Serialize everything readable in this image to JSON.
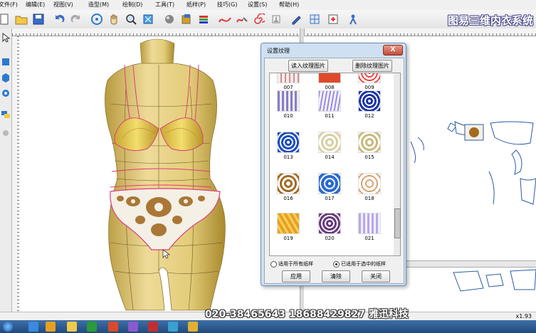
{
  "menu": [
    "文件(F)",
    "编辑(E)",
    "视图(V)",
    "造型(M)",
    "绘制(D)",
    "工具(T)",
    "纸样(P)",
    "技巧(G)",
    "设置(S)",
    "帮助(H)"
  ],
  "app_title": "图易三维内衣系统",
  "watermark": "020-38465643  18688429827  雅迅科技",
  "zoom": "x1.93",
  "dialog": {
    "title": "设置纹理",
    "close": "X",
    "load_button": "读入纹理图片",
    "delete_button": "删除纹理图片",
    "textures": [
      "007",
      "008",
      "009",
      "010",
      "011",
      "012",
      "013",
      "014",
      "015",
      "016",
      "017",
      "018",
      "019",
      "020",
      "021"
    ],
    "radio_all": "适用于所有纸样",
    "radio_selected": "已适用于选中的纸样",
    "apply_button": "应用",
    "clear_button": "清除",
    "close_button": "关闭"
  }
}
